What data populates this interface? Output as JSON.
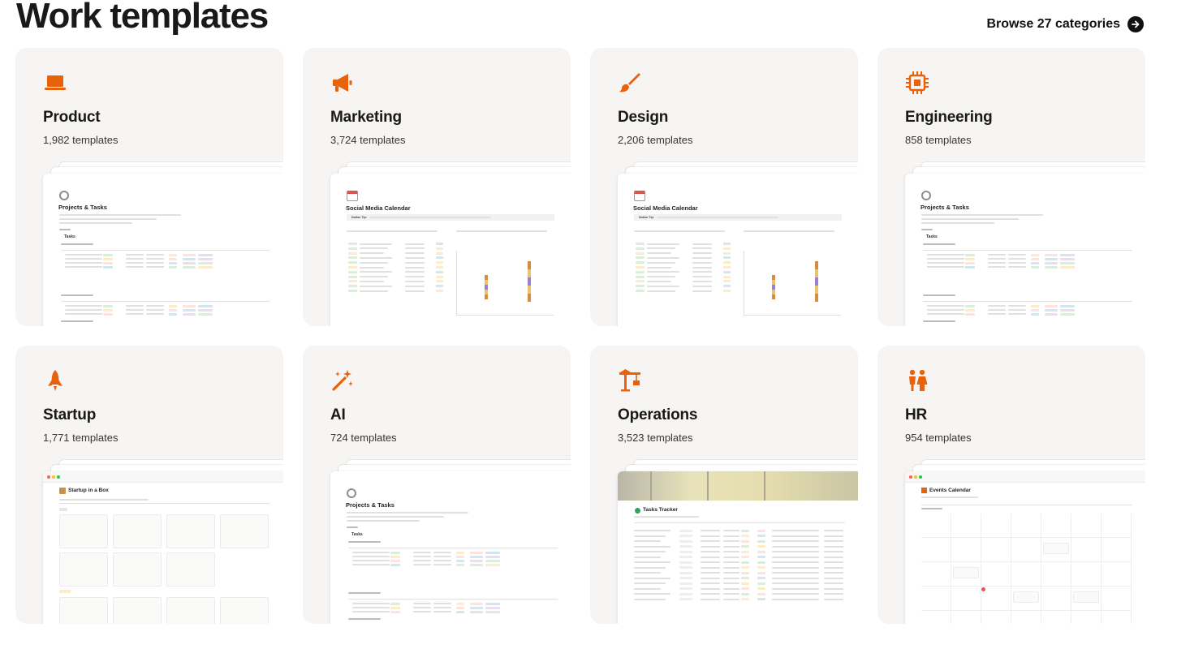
{
  "header": {
    "title": "Work templates",
    "browse_label": "Browse 27 categories"
  },
  "colors": {
    "accent": "#e8620c",
    "card_bg": "#f6f5f4"
  },
  "categories": [
    {
      "name": "Product",
      "count": "1,982 templates",
      "icon": "laptop-icon",
      "preview": {
        "kind": "projects",
        "title": "Projects & Tasks",
        "section": "Tasks"
      }
    },
    {
      "name": "Marketing",
      "count": "3,724 templates",
      "icon": "megaphone-icon",
      "preview": {
        "kind": "social",
        "title": "Social Media Calendar",
        "tip": "Notion Tip:"
      }
    },
    {
      "name": "Design",
      "count": "2,206 templates",
      "icon": "paintbrush-icon",
      "preview": {
        "kind": "social",
        "title": "Social Media Calendar",
        "tip": "Notion Tip:"
      }
    },
    {
      "name": "Engineering",
      "count": "858 templates",
      "icon": "chip-icon",
      "preview": {
        "kind": "projects",
        "title": "Projects & Tasks",
        "section": "Tasks"
      }
    },
    {
      "name": "Startup",
      "count": "1,771 templates",
      "icon": "rocket-icon",
      "preview": {
        "kind": "startup",
        "title": "Startup in a Box"
      }
    },
    {
      "name": "AI",
      "count": "724 templates",
      "icon": "magic-wand-icon",
      "preview": {
        "kind": "projects",
        "title": "Projects & Tasks",
        "section": "Tasks"
      }
    },
    {
      "name": "Operations",
      "count": "3,523 templates",
      "icon": "crane-icon",
      "preview": {
        "kind": "tracker",
        "title": "Tasks Tracker"
      }
    },
    {
      "name": "HR",
      "count": "954 templates",
      "icon": "people-icon",
      "preview": {
        "kind": "calendar",
        "title": "Events Calendar"
      }
    }
  ]
}
